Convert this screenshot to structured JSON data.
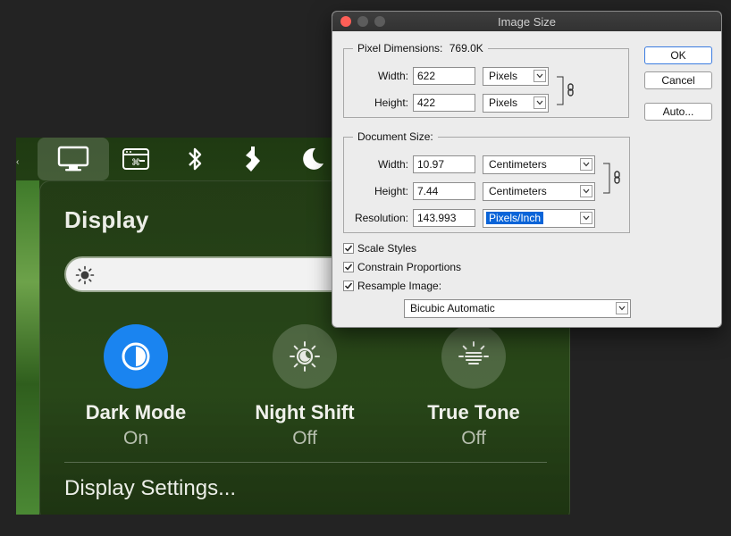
{
  "control_center": {
    "partial_left_glyph": "‹",
    "toolbar_icons": [
      "display-icon",
      "keyboard-brightness-icon",
      "bluetooth-icon",
      "accessibility-icon",
      "do-not-disturb-icon"
    ],
    "title": "Display",
    "brightness_icon": "sun-icon",
    "options": [
      {
        "name": "Dark Mode",
        "state": "On",
        "active": true
      },
      {
        "name": "Night Shift",
        "state": "Off",
        "active": false
      },
      {
        "name": "True Tone",
        "state": "Off",
        "active": false
      }
    ],
    "settings_label": "Display Settings..."
  },
  "dialog": {
    "title": "Image Size",
    "pixel_dimensions": {
      "legend": "Pixel Dimensions:",
      "size": "769.0K",
      "width_label": "Width:",
      "width_value": "622",
      "width_unit": "Pixels",
      "height_label": "Height:",
      "height_value": "422",
      "height_unit": "Pixels"
    },
    "document_size": {
      "legend": "Document Size:",
      "width_label": "Width:",
      "width_value": "10.97",
      "width_unit": "Centimeters",
      "height_label": "Height:",
      "height_value": "7.44",
      "height_unit": "Centimeters",
      "resolution_label": "Resolution:",
      "resolution_value": "143.993",
      "resolution_unit": "Pixels/Inch"
    },
    "checkboxes": [
      {
        "label": "Scale Styles",
        "checked": true
      },
      {
        "label": "Constrain Proportions",
        "checked": true
      },
      {
        "label": "Resample Image:",
        "checked": true
      }
    ],
    "resample_method": "Bicubic Automatic",
    "buttons": {
      "ok": "OK",
      "cancel": "Cancel",
      "auto": "Auto..."
    }
  }
}
